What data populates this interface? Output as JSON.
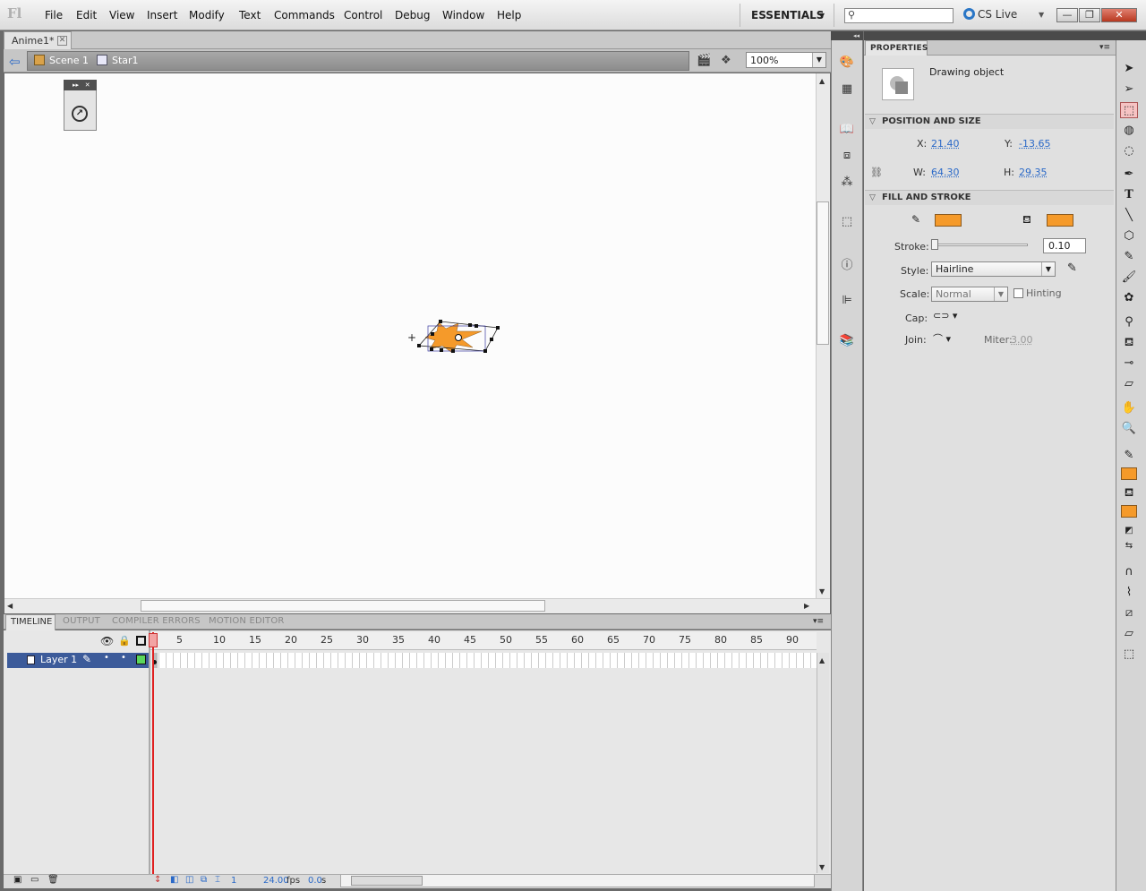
{
  "app": {
    "logo": "Fl",
    "workspace": "ESSENTIALS",
    "cs_live": "CS Live"
  },
  "menu": [
    "File",
    "Edit",
    "View",
    "Insert",
    "Modify",
    "Text",
    "Commands",
    "Control",
    "Debug",
    "Window",
    "Help"
  ],
  "window_buttons": {
    "minimize": "—",
    "restore": "❐",
    "close": "✕"
  },
  "document": {
    "tab_title": "Anime1*",
    "breadcrumb": [
      "Scene 1",
      "Star1"
    ],
    "zoom": "100%"
  },
  "timeline": {
    "tabs": [
      "TIMELINE",
      "OUTPUT",
      "COMPILER ERRORS",
      "MOTION EDITOR"
    ],
    "frame_numbers": [
      "5",
      "10",
      "15",
      "20",
      "25",
      "30",
      "35",
      "40",
      "45",
      "50",
      "55",
      "60",
      "65",
      "70",
      "75",
      "80",
      "85",
      "90"
    ],
    "layer_name": "Layer 1",
    "current_frame": "1",
    "fps": "24.00",
    "fps_unit": "fps",
    "elapsed": "0.0",
    "elapsed_unit": "s"
  },
  "properties": {
    "tab": "PROPERTIES",
    "object_type": "Drawing object",
    "position_section": "POSITION AND SIZE",
    "x_label": "X:",
    "x": "21.40",
    "y_label": "Y:",
    "y": "-13.65",
    "w_label": "W:",
    "w": "64.30",
    "h_label": "H:",
    "h": "29.35",
    "fill_section": "FILL AND STROKE",
    "stroke_label": "Stroke:",
    "stroke": "0.10",
    "style_label": "Style:",
    "style": "Hairline",
    "scale_label": "Scale:",
    "scale": "Normal",
    "hinting_label": "Hinting",
    "cap_label": "Cap:",
    "join_label": "Join:",
    "miter_label": "Miter:",
    "miter": "3.00",
    "fill_color": "#f59a2a",
    "stroke_color": "#f59a2a"
  },
  "accent_color": "#2a69c8"
}
